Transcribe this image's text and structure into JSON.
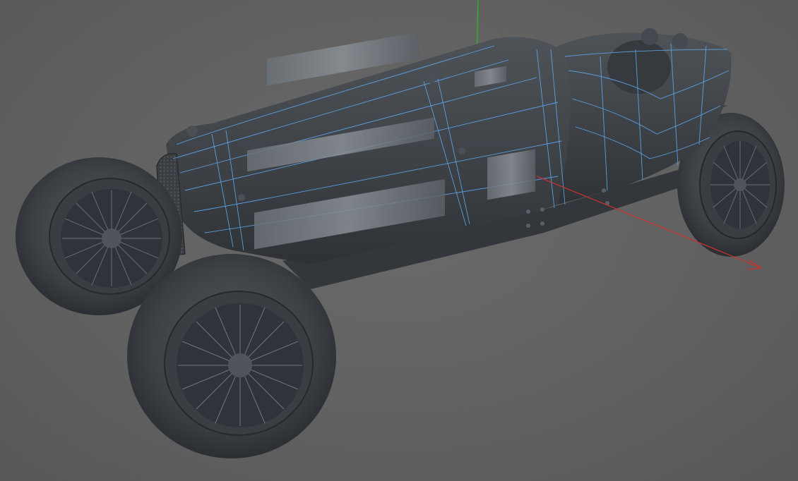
{
  "viewport": {
    "background_color": "#616161",
    "model_color": "#3f4348",
    "wireframe_color": "#5fa8f0",
    "axes": {
      "x_color": "#d03030",
      "y_color": "#22c02a"
    }
  },
  "model": {
    "wheel_icon": "wire-spoke-wheel",
    "engine_icon": "louvered-bonnet"
  }
}
